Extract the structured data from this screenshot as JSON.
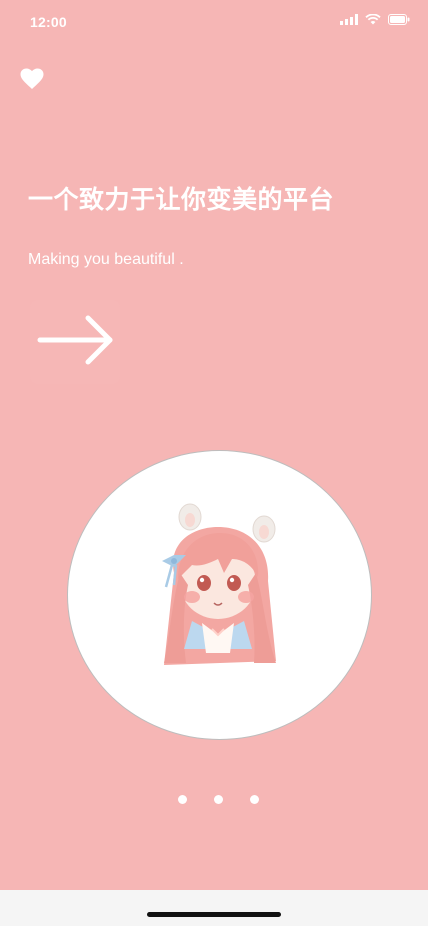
{
  "status_bar": {
    "time": "12:00",
    "icons": [
      "cellular-signal-icon",
      "wifi-icon",
      "battery-icon"
    ]
  },
  "header": {
    "icon": "heart-icon"
  },
  "content": {
    "title": "一个致力于让你变美的平台",
    "subtitle": "Making you beautiful .",
    "next_icon": "arrow-right-icon"
  },
  "illustration": {
    "name": "girl-avatar"
  },
  "pagination": {
    "count": 3,
    "active_index": 0
  },
  "colors": {
    "background": "#f6b6b5",
    "text": "#ffffff",
    "circle": "#ffffff"
  }
}
